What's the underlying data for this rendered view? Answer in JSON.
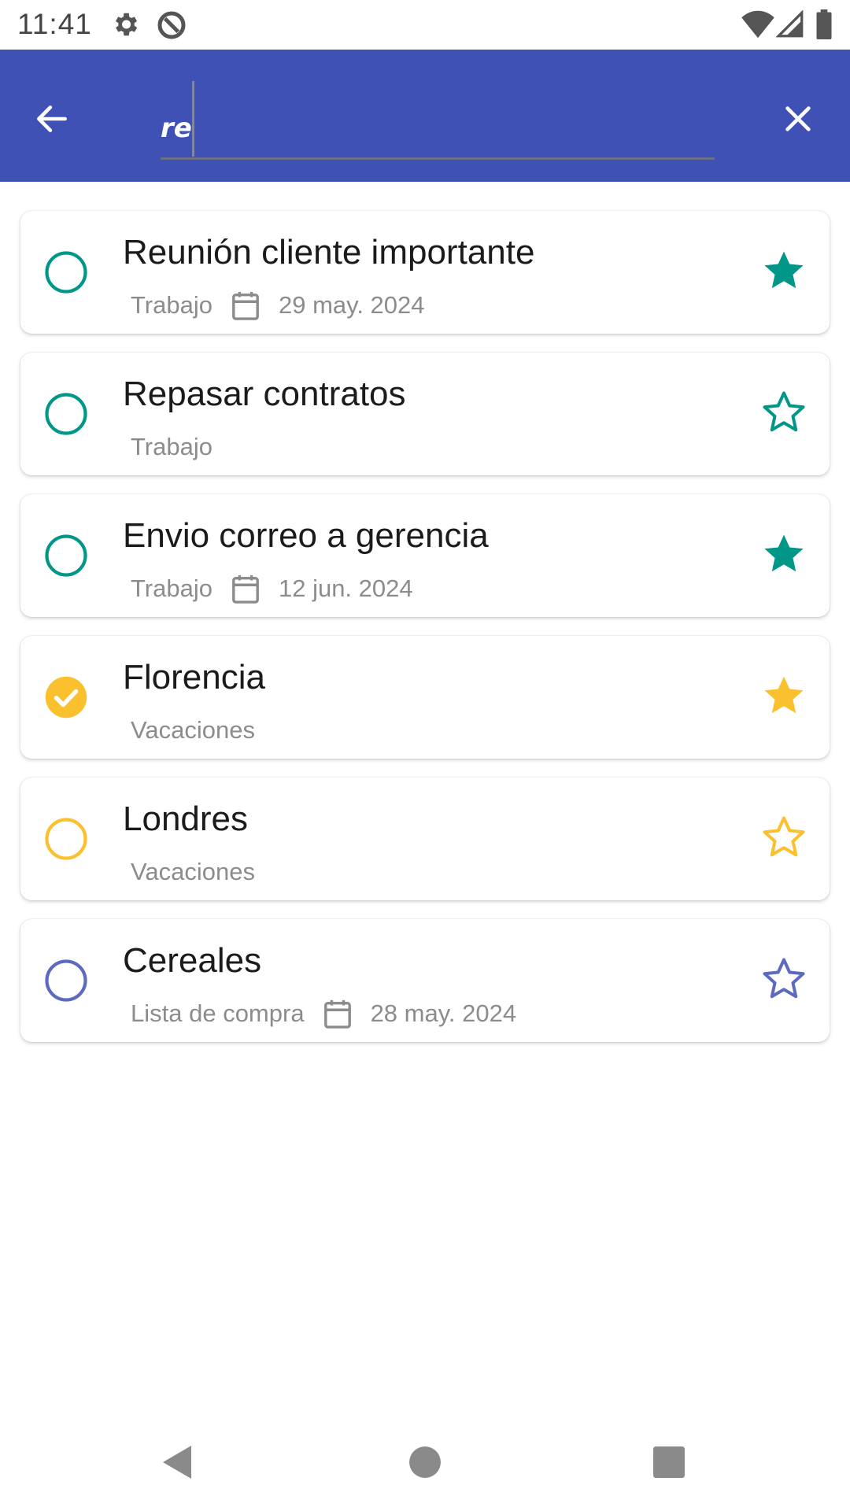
{
  "status_bar": {
    "time": "11:41",
    "icons": [
      "settings-icon",
      "sync-icon",
      "wifi-icon",
      "signal-icon",
      "battery-icon"
    ]
  },
  "search_bar": {
    "back_icon": "arrow-left-icon",
    "query": "re",
    "clear_icon": "close-icon",
    "background_color": "#3f51b5"
  },
  "tasks": [
    {
      "title": "Reunión cliente importante",
      "category": "Trabajo",
      "date": "29 may. 2024",
      "completed": false,
      "starred": true,
      "color": "#009688"
    },
    {
      "title": "Repasar contratos",
      "category": "Trabajo",
      "date": "",
      "completed": false,
      "starred": false,
      "color": "#009688"
    },
    {
      "title": "Envio correo a gerencia",
      "category": "Trabajo",
      "date": "12 jun. 2024",
      "completed": false,
      "starred": true,
      "color": "#009688"
    },
    {
      "title": "Florencia",
      "category": "Vacaciones",
      "date": "",
      "completed": true,
      "starred": true,
      "color": "#fbc02d"
    },
    {
      "title": "Londres",
      "category": "Vacaciones",
      "date": "",
      "completed": false,
      "starred": false,
      "color": "#fbc02d"
    },
    {
      "title": "Cereales",
      "category": "Lista de compra",
      "date": "28 may. 2024",
      "completed": false,
      "starred": false,
      "color": "#5c6bc0"
    }
  ],
  "nav_bar": {
    "icons": [
      "back-triangle-icon",
      "home-circle-icon",
      "recents-square-icon"
    ]
  }
}
